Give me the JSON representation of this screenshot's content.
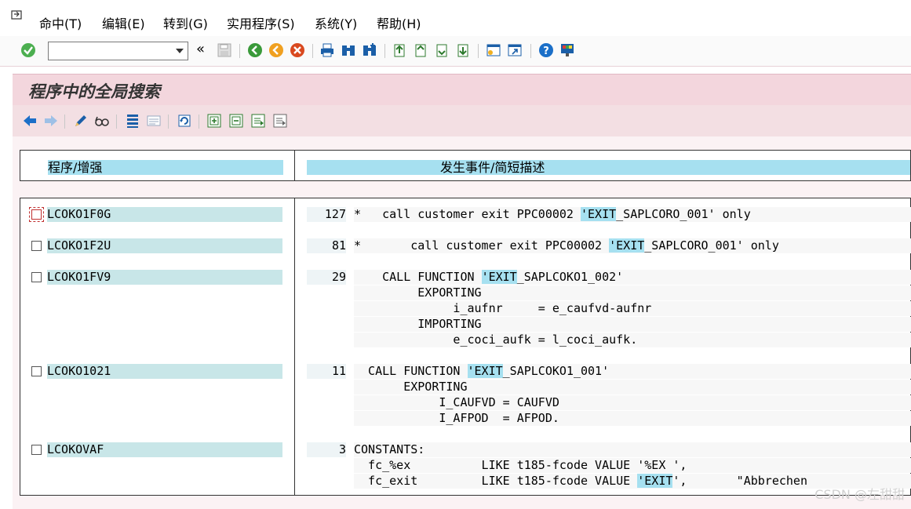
{
  "menubar": {
    "items": [
      "命中(T)",
      "编辑(E)",
      "转到(G)",
      "实用程序(S)",
      "系统(Y)",
      "帮助(H)"
    ]
  },
  "toolbar": {
    "command_value": ""
  },
  "title": "程序中的全局搜索",
  "columns": {
    "program": "程序/增强",
    "occurrence": "发生事件/简短描述"
  },
  "results": [
    {
      "program": "LCOKO1F0G",
      "lines": [
        {
          "num": "127",
          "before": "*   call customer exit PPC00002 ",
          "hit": "'EXIT",
          "after": "_SAPLCORO_001' only"
        }
      ]
    },
    {
      "program": "LCOKO1F2U",
      "lines": [
        {
          "num": "81",
          "before": "*       call customer exit PPC00002 ",
          "hit": "'EXIT",
          "after": "_SAPLCORO_001' only"
        }
      ]
    },
    {
      "program": "LCOKO1FV9",
      "lines": [
        {
          "num": "29",
          "before": "    CALL FUNCTION ",
          "hit": "'EXIT",
          "after": "_SAPLCOKO1_002'"
        },
        {
          "num": "",
          "before": "         EXPORTING",
          "hit": "",
          "after": ""
        },
        {
          "num": "",
          "before": "              i_aufnr     = e_caufvd-aufnr",
          "hit": "",
          "after": ""
        },
        {
          "num": "",
          "before": "         IMPORTING",
          "hit": "",
          "after": ""
        },
        {
          "num": "",
          "before": "              e_coci_aufk = l_coci_aufk.",
          "hit": "",
          "after": ""
        }
      ]
    },
    {
      "program": "LCOKO1021",
      "lines": [
        {
          "num": "11",
          "before": "  CALL FUNCTION ",
          "hit": "'EXIT",
          "after": "_SAPLCOKO1_001'"
        },
        {
          "num": "",
          "before": "       EXPORTING",
          "hit": "",
          "after": ""
        },
        {
          "num": "",
          "before": "            I_CAUFVD = CAUFVD",
          "hit": "",
          "after": ""
        },
        {
          "num": "",
          "before": "            I_AFPOD  = AFPOD.",
          "hit": "",
          "after": ""
        }
      ]
    },
    {
      "program": "LCOKOVAF",
      "lines": [
        {
          "num": "3",
          "before": "CONSTANTS:",
          "hit": "",
          "after": ""
        },
        {
          "num": "",
          "before": "  fc_%ex          LIKE t185-fcode VALUE '%EX ',",
          "hit": "",
          "after": ""
        },
        {
          "num": "",
          "before": "  fc_exit         LIKE t185-fcode VALUE ",
          "hit": "'EXIT",
          "after": "',       \"Abbrechen"
        }
      ]
    }
  ],
  "watermark": "CSDN @左甜甜",
  "colors": {
    "title_bar": "#f3d6dd",
    "header_highlight": "#a6e0f0",
    "program_cell": "#c8e6e8"
  }
}
